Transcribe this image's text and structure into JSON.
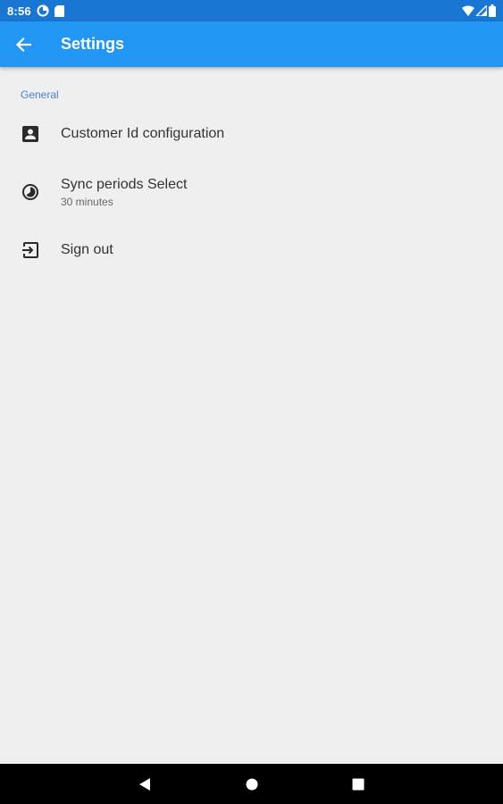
{
  "status_bar": {
    "time": "8:56",
    "icons": [
      "data-saver-icon",
      "sd-card-icon",
      "wifi-icon",
      "signal-icon",
      "battery-icon"
    ]
  },
  "app_bar": {
    "back_icon": "arrow-back-icon",
    "title": "Settings"
  },
  "settings": {
    "section_header": "General",
    "items": [
      {
        "icon": "account-box-icon",
        "title": "Customer Id configuration",
        "summary": ""
      },
      {
        "icon": "timelapse-icon",
        "title": "Sync periods Select",
        "summary": "30 minutes"
      },
      {
        "icon": "exit-to-app-icon",
        "title": "Sign out",
        "summary": ""
      }
    ]
  },
  "nav_bar": {
    "buttons": [
      "back-triangle-icon",
      "home-circle-icon",
      "recents-square-icon"
    ]
  },
  "colors": {
    "status_bar": "#1976d2",
    "app_bar": "#2196f3",
    "background": "#efefef",
    "section_header": "#4a7fd4",
    "nav_bar": "#000000"
  }
}
